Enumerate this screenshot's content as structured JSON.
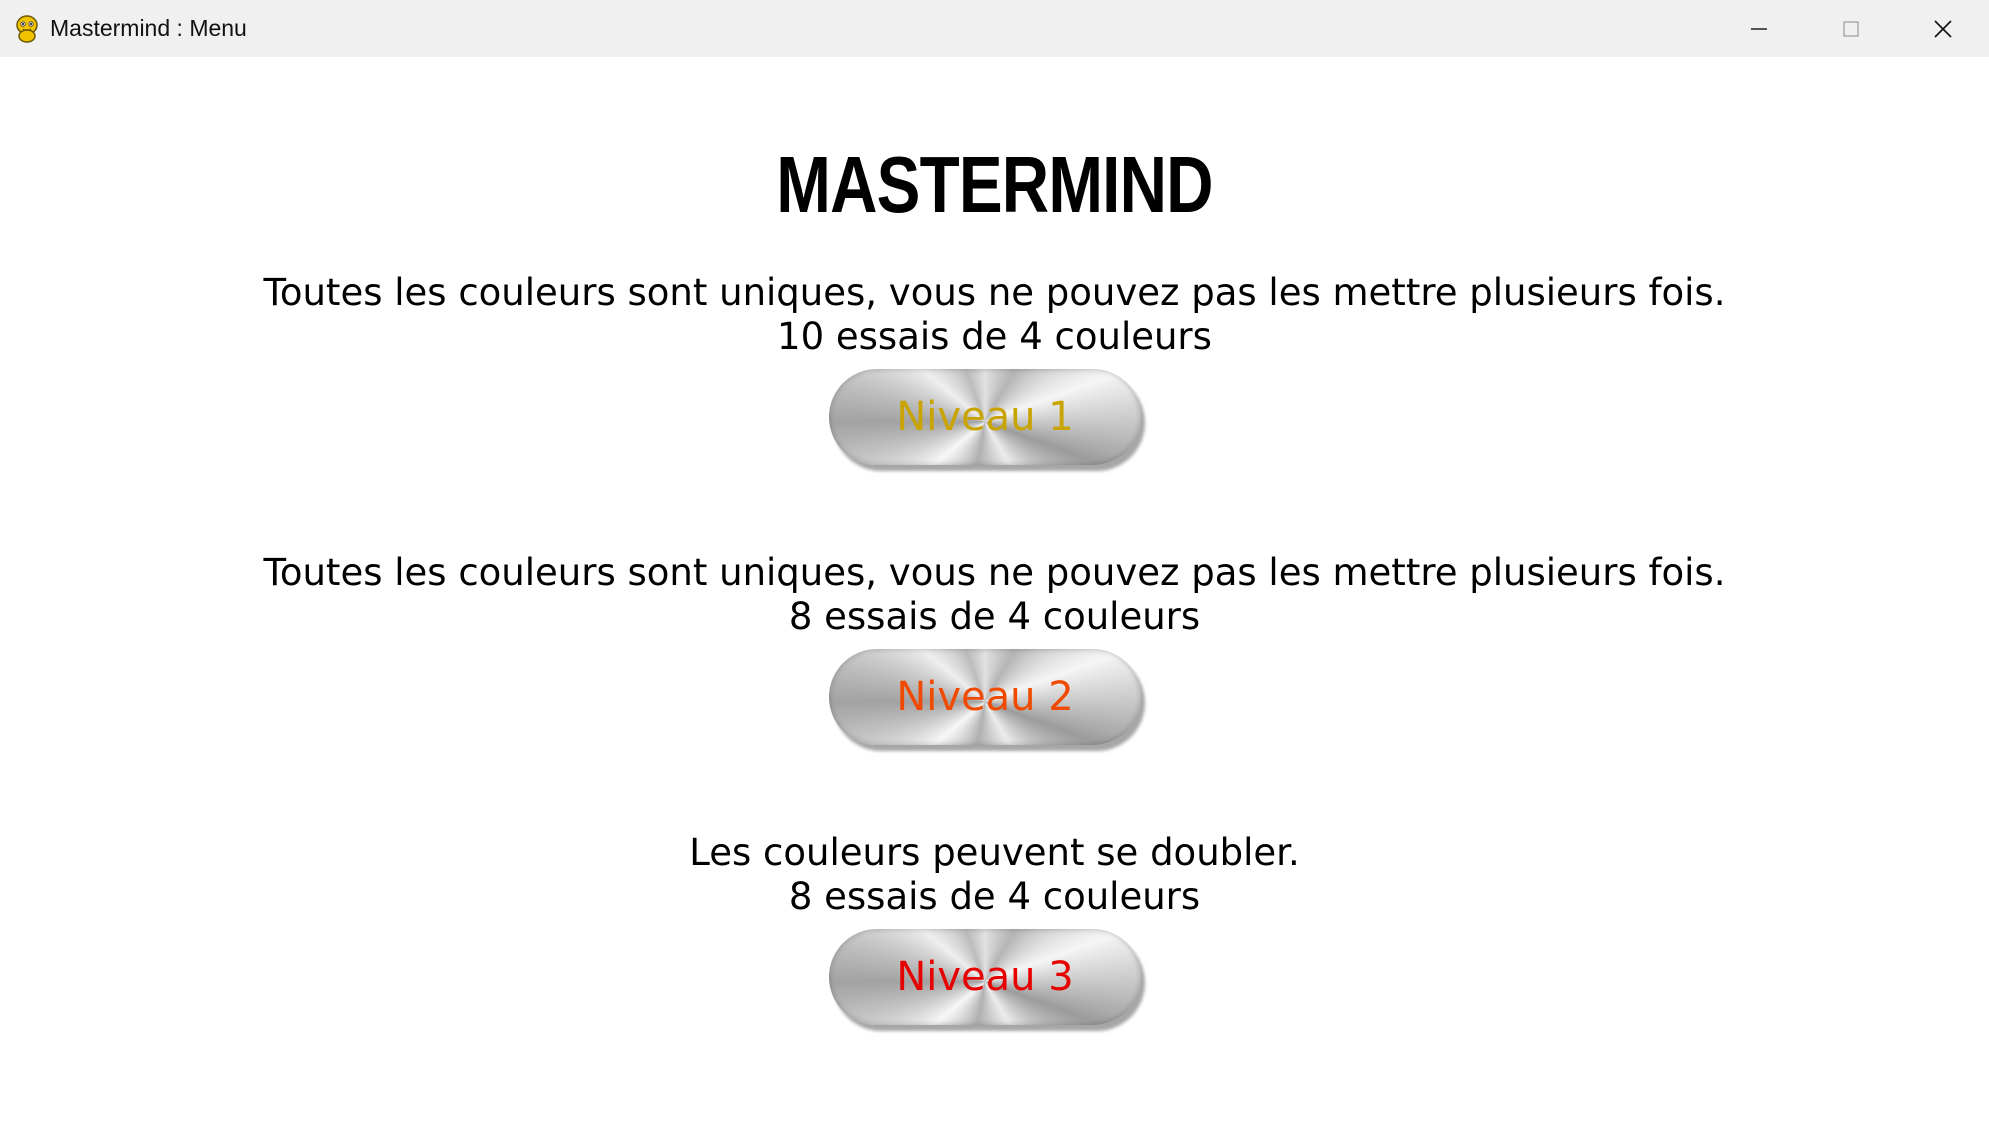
{
  "window": {
    "title": "Mastermind : Menu",
    "app_icon": "python-snake-icon",
    "controls": [
      "minimize-icon",
      "maximize-icon",
      "close-icon"
    ]
  },
  "main": {
    "title": "MASTERMIND",
    "levels": [
      {
        "rule": "Toutes les couleurs sont uniques, vous ne pouvez pas les mettre plusieurs fois.",
        "attempts": "10 essais de 4 couleurs",
        "button_label": "Niveau 1",
        "button_color": "#c9a400"
      },
      {
        "rule": "Toutes les couleurs sont uniques, vous ne pouvez pas les mettre plusieurs fois.",
        "attempts": "8 essais de 4 couleurs",
        "button_label": "Niveau 2",
        "button_color": "#f04a00"
      },
      {
        "rule": "Les couleurs peuvent se doubler.",
        "attempts": "8 essais de 4 couleurs",
        "button_label": "Niveau 3",
        "button_color": "#e60000"
      }
    ]
  }
}
